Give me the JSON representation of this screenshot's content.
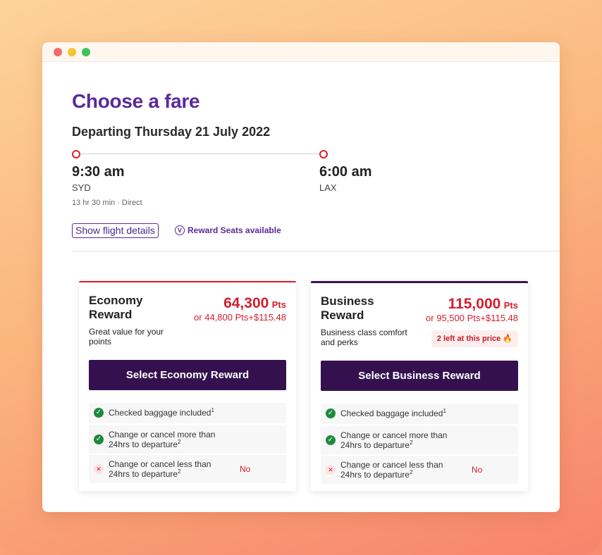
{
  "page": {
    "title": "Choose a fare",
    "departing": "Departing Thursday 21 July 2022"
  },
  "flight": {
    "departure_time": "9:30 am",
    "departure_airport": "SYD",
    "arrival_time": "6:00 am",
    "arrival_airport": "LAX",
    "duration": "13 hr 30 min · Direct",
    "details_button": "Show flight details",
    "reward_seats": "Reward Seats available",
    "reward_icon": "V"
  },
  "fares": {
    "economy": {
      "name": "Economy Reward",
      "description": "Great value for your points",
      "points": "64,300",
      "points_unit": "Pts",
      "alt_price": "or 44,800 Pts+$115.48",
      "button": "Select Economy Reward",
      "features": [
        {
          "text": "Checked baggage included",
          "sup": "1",
          "status": "check",
          "value": ""
        },
        {
          "text_line1": "Change or cancel more than",
          "text_line2": "24hrs to departure",
          "sup": "2",
          "status": "check",
          "value": ""
        },
        {
          "text_line1": "Change or cancel less than",
          "text_line2": "24hrs to departure",
          "sup": "2",
          "status": "cross",
          "value": "No"
        }
      ]
    },
    "business": {
      "name": "Business Reward",
      "description": "Business class comfort and perks",
      "points": "115,000",
      "points_unit": "Pts",
      "alt_price": "or 95,500 Pts+$115.48",
      "scarcity": "2 left at this price 🔥",
      "button": "Select Business Reward",
      "features": [
        {
          "text": "Checked baggage included",
          "sup": "1",
          "status": "check",
          "value": ""
        },
        {
          "text_line1": "Change or cancel more than",
          "text_line2": "24hrs to departure",
          "sup": "2",
          "status": "check",
          "value": ""
        },
        {
          "text_line1": "Change or cancel less than",
          "text_line2": "24hrs to departure",
          "sup": "2",
          "status": "cross",
          "value": "No"
        }
      ]
    }
  },
  "icons": {
    "check": "✓",
    "cross": "✕"
  },
  "colors": {
    "brand_purple": "#5a2a9a",
    "button_dark": "#34114e",
    "accent_red": "#d21f2d",
    "success_green": "#1f8a3b"
  }
}
